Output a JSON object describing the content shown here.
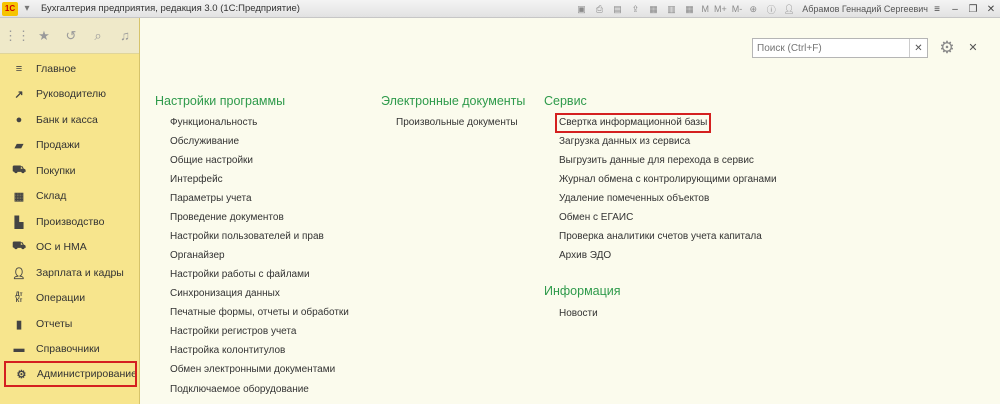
{
  "window": {
    "title": "Бухгалтерия предприятия, редакция 3.0  (1С:Предприятие)",
    "logo": "1С",
    "user": "Абрамов Геннадий Сергеевич",
    "memory_labels": [
      "M",
      "M+",
      "M-"
    ]
  },
  "sidebar": {
    "items": [
      {
        "label": "Главное",
        "icon": "menu-icon"
      },
      {
        "label": "Руководителю",
        "icon": "trend-icon"
      },
      {
        "label": "Банк и касса",
        "icon": "coin-icon"
      },
      {
        "label": "Продажи",
        "icon": "bag-icon"
      },
      {
        "label": "Покупки",
        "icon": "cart-icon"
      },
      {
        "label": "Склад",
        "icon": "warehouse-icon"
      },
      {
        "label": "Производство",
        "icon": "factory-icon"
      },
      {
        "label": "ОС и НМА",
        "icon": "truck-icon"
      },
      {
        "label": "Зарплата и кадры",
        "icon": "person-icon"
      },
      {
        "label": "Операции",
        "icon": "dtkt-icon",
        "glyph": "Дт\nКт"
      },
      {
        "label": "Отчеты",
        "icon": "bar-chart-icon"
      },
      {
        "label": "Справочники",
        "icon": "book-icon"
      },
      {
        "label": "Администрирование",
        "icon": "gear-icon"
      }
    ]
  },
  "search": {
    "placeholder": "Поиск (Ctrl+F)"
  },
  "columns": {
    "settings": {
      "header": "Настройки программы",
      "links": [
        "Функциональность",
        "Обслуживание",
        "Общие настройки",
        "Интерфейс",
        "Параметры учета",
        "Проведение документов",
        "Настройки пользователей и прав",
        "Органайзер",
        "Настройки работы с файлами",
        "Синхронизация данных",
        "Печатные формы, отчеты и обработки",
        "Настройки регистров учета",
        "Настройка колонтитулов",
        "Обмен электронными документами",
        "Подключаемое оборудование"
      ]
    },
    "edocs": {
      "header": "Электронные документы",
      "links": [
        "Произвольные документы"
      ]
    },
    "service": {
      "header": "Сервис",
      "links": [
        "Свертка информационной базы",
        "Загрузка данных из сервиса",
        "Выгрузить данные для перехода в сервис",
        "Журнал обмена с контролирующими органами",
        "Удаление помеченных объектов",
        "Обмен с ЕГАИС",
        "Проверка аналитики счетов учета капитала",
        "Архив ЭДО"
      ]
    },
    "info": {
      "header": "Информация",
      "links": [
        "Новости"
      ]
    }
  },
  "colors": {
    "sidebar_bg": "#f7e58d",
    "main_bg": "#fbfbed",
    "header_green": "#2e9a4b",
    "highlight_red": "#d42020"
  }
}
